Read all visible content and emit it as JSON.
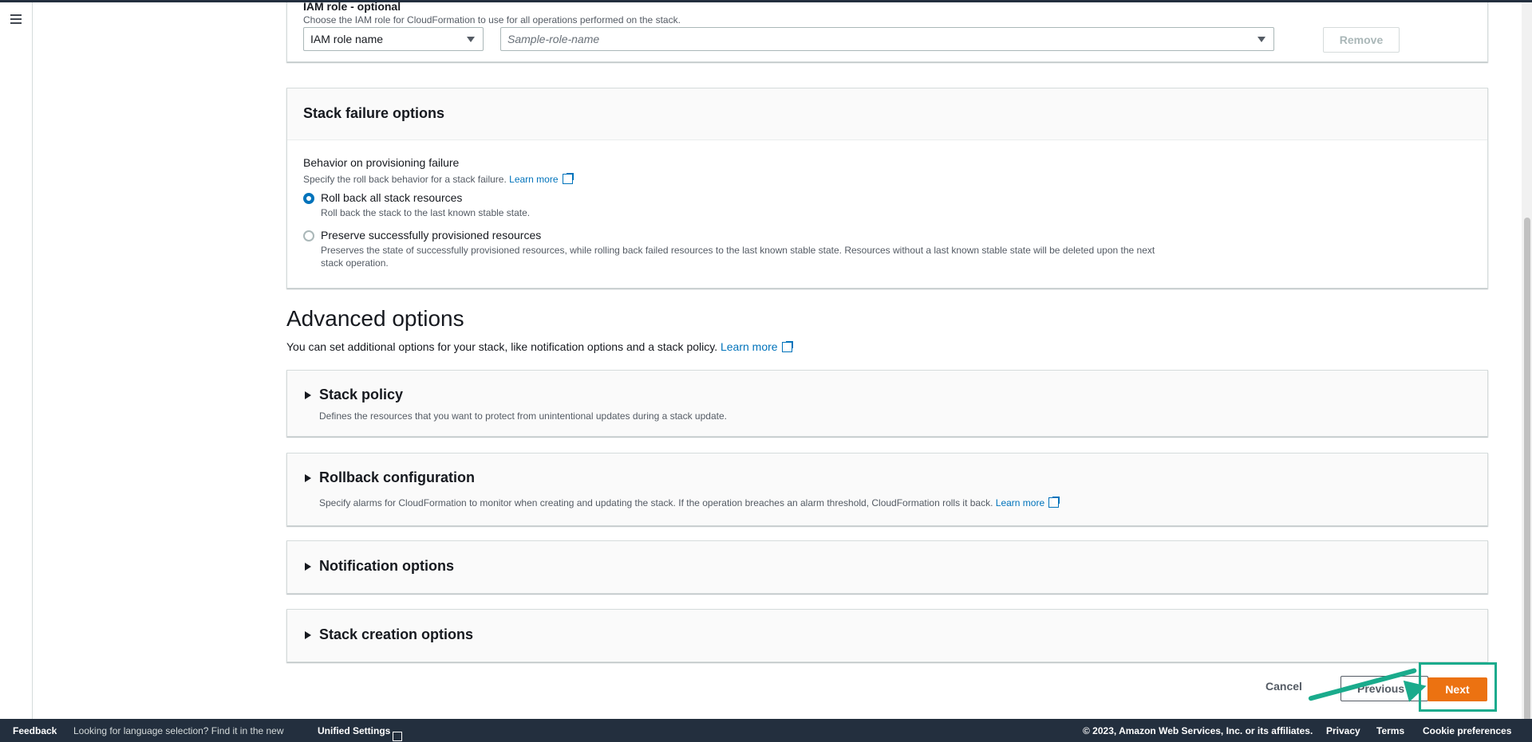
{
  "iam": {
    "title": "IAM role - optional",
    "description": "Choose the IAM role for CloudFormation to use for all operations performed on the stack.",
    "type_select": "IAM role name",
    "role_placeholder": "Sample-role-name",
    "remove_label": "Remove"
  },
  "failure": {
    "title": "Stack failure options",
    "behavior_label": "Behavior on provisioning failure",
    "behavior_desc": "Specify the roll back behavior for a stack failure.",
    "learn_more": "Learn more",
    "options": [
      {
        "label": "Roll back all stack resources",
        "desc": "Roll back the stack to the last known stable state.",
        "checked": true
      },
      {
        "label": "Preserve successfully provisioned resources",
        "desc": "Preserves the state of successfully provisioned resources, while rolling back failed resources to the last known stable state. Resources without a last known stable state will be deleted upon the next stack operation.",
        "checked": false
      }
    ]
  },
  "advanced": {
    "title": "Advanced options",
    "desc": "You can set additional options for your stack, like notification options and a stack policy.",
    "learn_more": "Learn more",
    "sections": [
      {
        "title": "Stack policy",
        "desc": "Defines the resources that you want to protect from unintentional updates during a stack update."
      },
      {
        "title": "Rollback configuration",
        "desc": "Specify alarms for CloudFormation to monitor when creating and updating the stack. If the operation breaches an alarm threshold, CloudFormation rolls it back.",
        "learn_more": "Learn more"
      },
      {
        "title": "Notification options"
      },
      {
        "title": "Stack creation options"
      }
    ]
  },
  "actions": {
    "cancel": "Cancel",
    "previous": "Previous",
    "next": "Next"
  },
  "footer": {
    "feedback": "Feedback",
    "lang_prompt": "Looking for language selection? Find it in the new",
    "unified_settings": "Unified Settings",
    "copyright": "© 2023, Amazon Web Services, Inc. or its affiliates.",
    "privacy": "Privacy",
    "terms": "Terms",
    "cookie": "Cookie preferences"
  },
  "colors": {
    "primary_button": "#ec7211",
    "link": "#0073bb",
    "annotation": "#1aab8c",
    "footer_bg": "#232f3e"
  }
}
